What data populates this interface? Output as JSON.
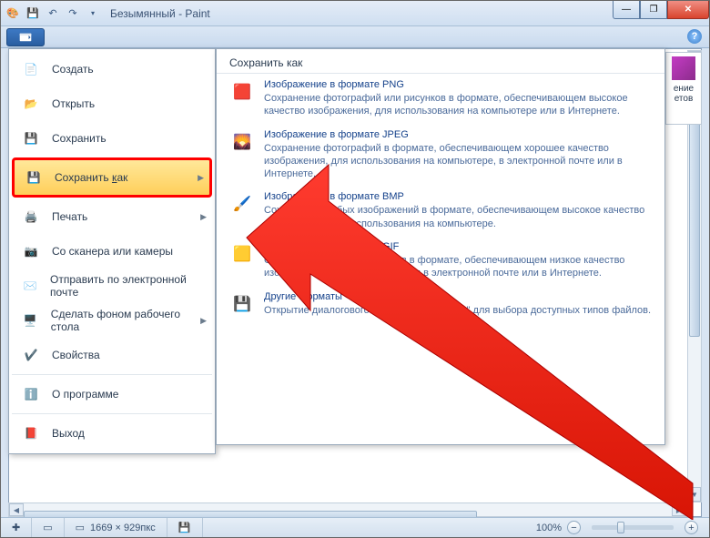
{
  "window": {
    "title": "Безымянный - Paint"
  },
  "menu": {
    "items": [
      {
        "label": "Создать",
        "icon": "file-new-icon"
      },
      {
        "label": "Открыть",
        "icon": "folder-open-icon"
      },
      {
        "label": "Сохранить",
        "icon": "floppy-icon"
      },
      {
        "label": "Сохранить как",
        "icon": "floppy-arrow-icon",
        "selected": true,
        "sub": "▶"
      },
      {
        "label": "Печать",
        "icon": "printer-icon",
        "sub": "▶"
      },
      {
        "label": "Со сканера или камеры",
        "icon": "scanner-icon"
      },
      {
        "label": "Отправить по электронной почте",
        "icon": "mail-icon"
      },
      {
        "label": "Сделать фоном рабочего стола",
        "icon": "desktop-icon",
        "sub": "▶"
      },
      {
        "label": "Свойства",
        "icon": "check-icon"
      },
      {
        "label": "О программе",
        "icon": "info-icon"
      },
      {
        "label": "Выход",
        "icon": "exit-icon"
      }
    ]
  },
  "submenu": {
    "title": "Сохранить как",
    "items": [
      {
        "title": "Изображение в формате PNG",
        "desc": "Сохранение фотографий или рисунков в формате, обеспечивающем высокое качество изображения, для использования на компьютере или в Интернете."
      },
      {
        "title": "Изображение в формате JPEG",
        "desc": "Сохранение фотографий в формате, обеспечивающем хорошее качество изображения, для использования на компьютере, в электронной почте или в Интернете."
      },
      {
        "title": "Изображение в формате BMP",
        "desc": "Сохранение любых изображений в формате, обеспечивающем высокое качество изображения, для использования на компьютере."
      },
      {
        "title": "Изображение в формате GIF",
        "desc": "Сохранение простых рисунков в формате, обеспечивающем низкое качество изображения, для использования в электронной почте или в Интернете."
      },
      {
        "title": "Другие форматы",
        "desc": "Открытие диалогового окна \"Сохранить как\" для выбора доступных типов файлов."
      }
    ]
  },
  "rightclip": {
    "line1": "ение",
    "line2": "етов"
  },
  "status": {
    "dims": "1669 × 929пкс",
    "zoom": "100%"
  }
}
